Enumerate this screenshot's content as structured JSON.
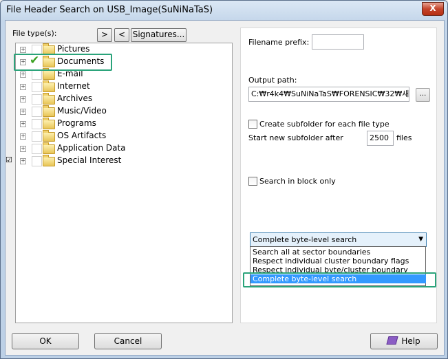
{
  "window": {
    "title": "File Header Search on USB_Image(SuNiNaTaS)",
    "close_label": "X"
  },
  "left": {
    "file_types_label": "File type(s):",
    "expand_button": ">",
    "collapse_button": "<",
    "signatures_button": "Signatures...",
    "side_mark": "☑",
    "tree": [
      {
        "label": "Pictures",
        "checked": false
      },
      {
        "label": "Documents",
        "checked": true
      },
      {
        "label": "E-mail",
        "checked": false
      },
      {
        "label": "Internet",
        "checked": false
      },
      {
        "label": "Archives",
        "checked": false
      },
      {
        "label": "Music/Video",
        "checked": false
      },
      {
        "label": "Programs",
        "checked": false
      },
      {
        "label": "OS Artifacts",
        "checked": false
      },
      {
        "label": "Application Data",
        "checked": false
      },
      {
        "label": "Special Interest",
        "checked": false
      }
    ]
  },
  "right": {
    "filename_prefix_label": "Filename prefix:",
    "filename_prefix_value": "",
    "output_path_label": "Output path:",
    "output_path_value": "C:₩r4k4₩SuNiNaTaS₩FORENSIC₩32₩새",
    "browse_label": "...",
    "create_subfolder_label": "Create subfolder for each file type",
    "start_subfolder_label": "Start new subfolder after",
    "start_subfolder_value": "2500",
    "files_label": "files",
    "block_only_label": "Search in block only",
    "search_mode_selected": "Complete byte-level search",
    "search_mode_options": [
      "Search all at sector boundaries",
      "Respect individual cluster boundary flags",
      "Respect individual byte/cluster boundary flags",
      "Complete byte-level search"
    ]
  },
  "footer": {
    "ok": "OK",
    "cancel": "Cancel",
    "help": "Help"
  },
  "colors": {
    "highlight": "#2aa37a",
    "selection": "#3399ff"
  }
}
